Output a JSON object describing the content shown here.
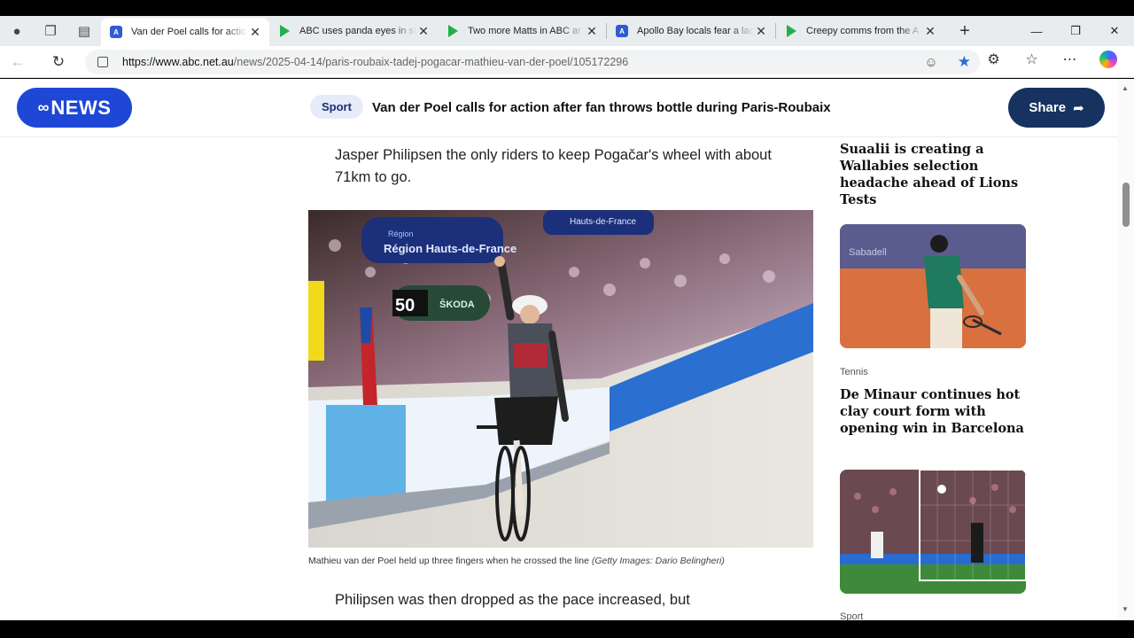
{
  "tabs": [
    {
      "title": "Van der Poel calls for actio",
      "favicon": "abc-icon",
      "active": true
    },
    {
      "title": "ABC uses panda eyes in st",
      "favicon": "play-icon",
      "active": false
    },
    {
      "title": "Two more Matts in ABC ar",
      "favicon": "play-icon",
      "active": false
    },
    {
      "title": "Apollo Bay locals fear a lac",
      "favicon": "abc-icon",
      "active": false
    },
    {
      "title": "Creepy comms from the A",
      "favicon": "play-icon",
      "active": false
    }
  ],
  "url": {
    "domain": "https://www.abc.net.au",
    "path": "/news/2025-04-14/paris-roubaix-tadej-pogacar-mathieu-van-der-poel/105172296"
  },
  "header": {
    "logo_text": "NEWS",
    "logo_mark": "ABC",
    "category": "Sport",
    "title": "Van der Poel calls for action after fan throws bottle during Paris-Roubaix",
    "share_label": "Share"
  },
  "article": {
    "para_top": "Jasper Philipsen the only riders to keep Pogačar's wheel with about 71km to go.",
    "caption_main": "Mathieu van der Poel held up three fingers when he crossed the line",
    "caption_credit": "(Getty Images: Dario Belingheri)",
    "para_bottom": "Philipsen was then dropped as the pace increased, but"
  },
  "photo_text": {
    "banner1": "Région Hauts-de-France",
    "banner2": "Hauts-de-France",
    "sponsor": "ŠKODA",
    "number": "50"
  },
  "sidebar": {
    "story1_title": "Suaalii is creating a Wallabies selection headache ahead of Lions Tests",
    "story2_category": "Tennis",
    "story2_title": "De Minaur continues hot clay court form with opening win in Barcelona",
    "story3_category": "Sport",
    "thumb1_banner": "Sabadell"
  },
  "colors": {
    "abc_blue": "#1e47d6",
    "share_navy": "#16325f",
    "pill_bg": "#e6ebf8"
  }
}
